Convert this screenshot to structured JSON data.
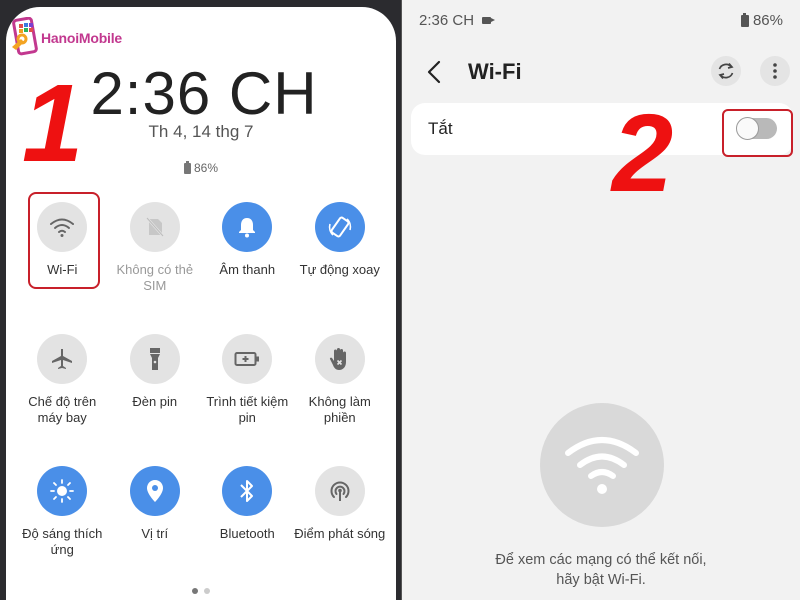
{
  "watermark": {
    "brand": "HanoiMobile"
  },
  "annotations": {
    "step1": "1",
    "step2": "2"
  },
  "quick_settings": {
    "clock": "2:36 CH",
    "date": "Th 4, 14 thg 7",
    "battery": "86%",
    "tiles": [
      {
        "id": "wifi",
        "label": "Wi-Fi",
        "icon": "wifi-icon",
        "state": "off",
        "highlighted": true
      },
      {
        "id": "sim",
        "label": "Không có thẻ SIM",
        "icon": "no-sim-icon",
        "state": "disabled"
      },
      {
        "id": "sound",
        "label": "Âm thanh",
        "icon": "bell-icon",
        "state": "on"
      },
      {
        "id": "rotate",
        "label": "Tự động xoay",
        "icon": "auto-rotate-icon",
        "state": "on"
      },
      {
        "id": "airplane",
        "label": "Chế độ trên máy bay",
        "icon": "airplane-icon",
        "state": "off"
      },
      {
        "id": "flashlight",
        "label": "Đèn pin",
        "icon": "flashlight-icon",
        "state": "off"
      },
      {
        "id": "battery_saver",
        "label": "Trình tiết kiệm pin",
        "icon": "battery-saver-icon",
        "state": "off"
      },
      {
        "id": "dnd",
        "label": "Không làm phiền",
        "icon": "do-not-disturb-icon",
        "state": "off"
      },
      {
        "id": "brightness",
        "label": "Độ sáng thích ứng",
        "icon": "brightness-icon",
        "state": "on"
      },
      {
        "id": "location",
        "label": "Vị trí",
        "icon": "location-icon",
        "state": "on"
      },
      {
        "id": "bluetooth",
        "label": "Bluetooth",
        "icon": "bluetooth-icon",
        "state": "on"
      },
      {
        "id": "hotspot",
        "label": "Điểm phát sóng",
        "icon": "hotspot-icon",
        "state": "off"
      }
    ],
    "page_indicator": {
      "current": 1,
      "total": 2
    }
  },
  "wifi_settings": {
    "status_bar": {
      "time": "2:36 CH",
      "battery": "86%"
    },
    "title": "Wi-Fi",
    "toggle": {
      "label": "Tắt",
      "on": false
    },
    "empty_hint_line1": "Để xem các mạng có thể kết nối,",
    "empty_hint_line2": "hãy bật Wi-Fi."
  },
  "colors": {
    "accent_on": "#4a8fe8",
    "tile_off": "#e3e3e3",
    "highlight": "#c8202a",
    "annotation": "#ee1111",
    "brand": "#c2388f"
  }
}
